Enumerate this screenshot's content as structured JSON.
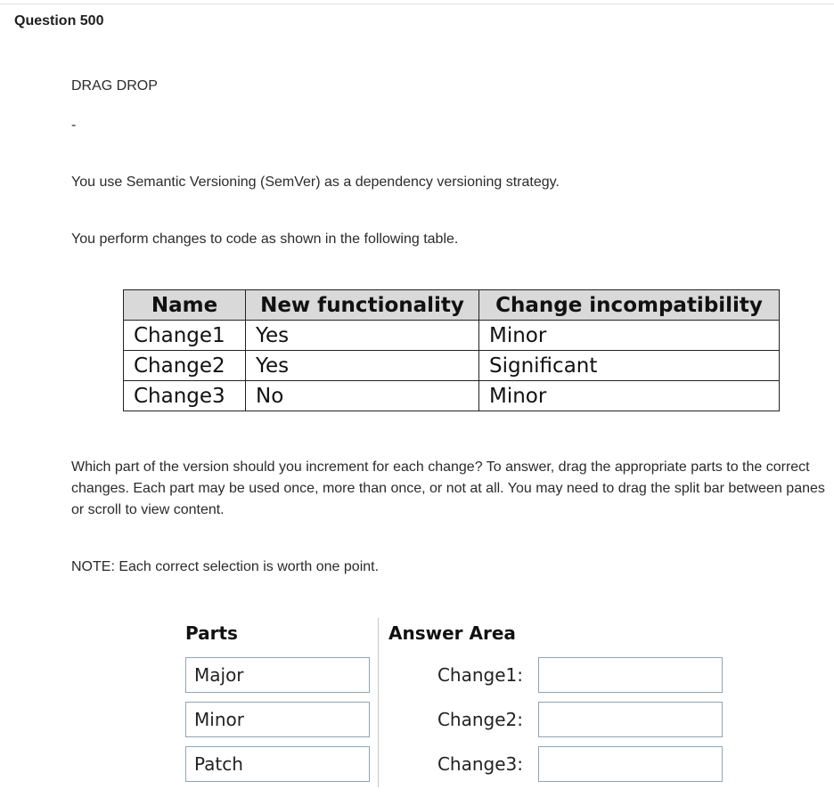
{
  "question": {
    "title": "Question 500"
  },
  "body": {
    "type_label": "DRAG DROP",
    "dash": "-",
    "intro": "You use Semantic Versioning (SemVer) as a dependency versioning strategy.",
    "table_intro": "You perform changes to code as shown in the following table.",
    "instructions": "Which part of the version should you increment for each change? To answer, drag the appropriate parts to the correct changes. Each part may be used once, more than once, or not at all. You may need to drag the split bar between panes or scroll to view content.",
    "note": "NOTE: Each correct selection is worth one point."
  },
  "table": {
    "headers": [
      "Name",
      "New functionality",
      "Change incompatibility"
    ],
    "rows": [
      [
        "Change1",
        "Yes",
        "Minor"
      ],
      [
        "Change2",
        "Yes",
        "Significant"
      ],
      [
        "Change3",
        "No",
        "Minor"
      ]
    ]
  },
  "dragdrop": {
    "parts_heading": "Parts",
    "answer_heading": "Answer Area",
    "parts": [
      "Major",
      "Minor",
      "Patch"
    ],
    "targets": [
      "Change1:",
      "Change2:",
      "Change3:"
    ]
  }
}
